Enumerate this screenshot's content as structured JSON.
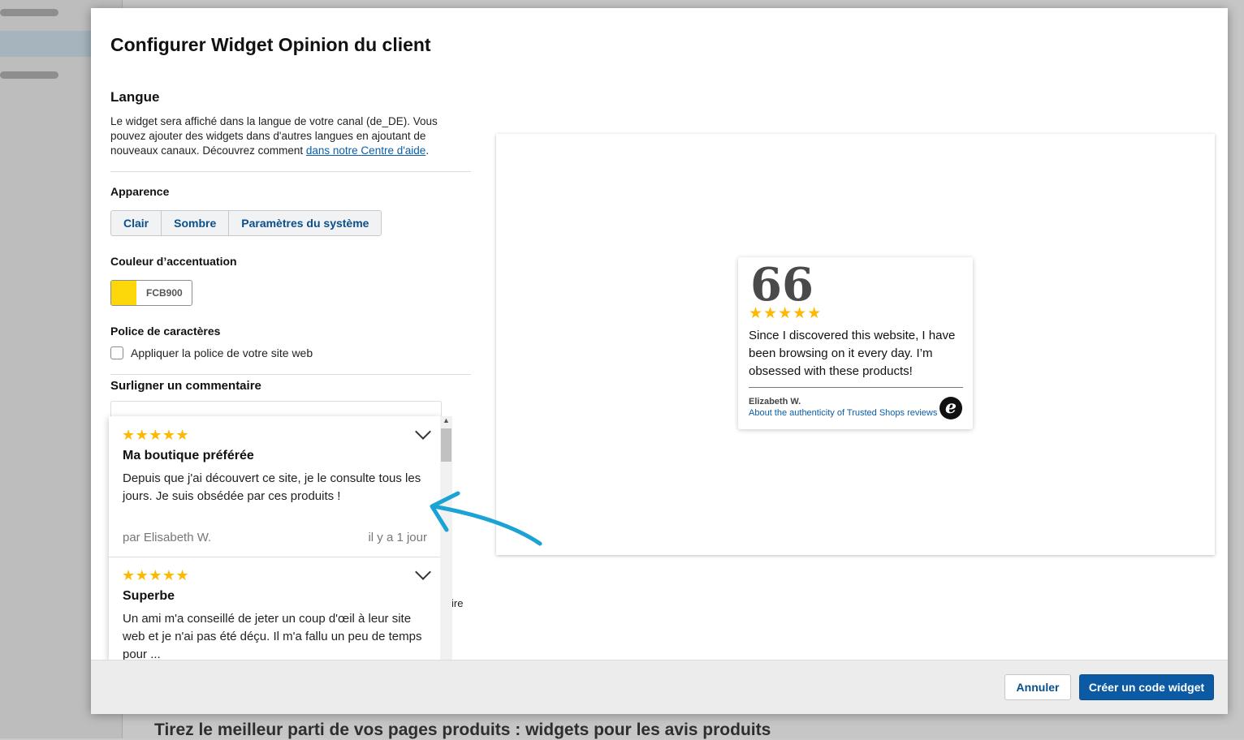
{
  "background": {
    "heading": "Tirez le meilleur parti de vos pages produits : widgets pour les avis produits"
  },
  "modal": {
    "title": "Configurer Widget Opinion du client",
    "language": {
      "heading": "Langue",
      "text": "Le widget sera affiché dans la langue de votre canal (de_DE). Vous pouvez ajouter des widgets dans d'autres langues en ajoutant de nouveaux canaux. Découvrez comment ",
      "link": "dans notre Centre d'aide",
      "text_end": "."
    },
    "appearance": {
      "label": "Apparence",
      "options": [
        "Clair",
        "Sombre",
        "Paramètres du système"
      ]
    },
    "accent": {
      "label": "Couleur d’accentuation",
      "value": "FCB900",
      "color": "#FCD80A"
    },
    "font": {
      "label": "Police de caractères",
      "checkbox_label": "Appliquer la police de votre site web",
      "checked": false
    },
    "highlight": {
      "label": "Surligner un commentaire",
      "items": [
        {
          "stars": "★★★★★",
          "title": "Ma boutique préférée",
          "body": "Depuis que j'ai découvert ce site, je le consulte tous les jours. Je suis obsédée par ces produits !",
          "author": "par Elisabeth W.",
          "date": "il y a 1 jour"
        },
        {
          "stars": "★★★★★",
          "title": "Superbe",
          "body": "Un ami m'a conseillé de jeter un coup d'œil à leur site web et je n'ai pas été déçu. Il m'a fallu un peu de temps pour ..."
        }
      ],
      "trailing_text": "ire"
    },
    "preview": {
      "quote_mark": "66",
      "stars": "★★★★★",
      "text": "Since I discovered this website, I have been browsing on it every day. I’m obsessed with these products!",
      "author": "Elizabeth W.",
      "link": "About the authenticity of Trusted Shops reviews",
      "logo": "e"
    },
    "footer": {
      "cancel": "Annuler",
      "create": "Créer un code widget"
    }
  }
}
